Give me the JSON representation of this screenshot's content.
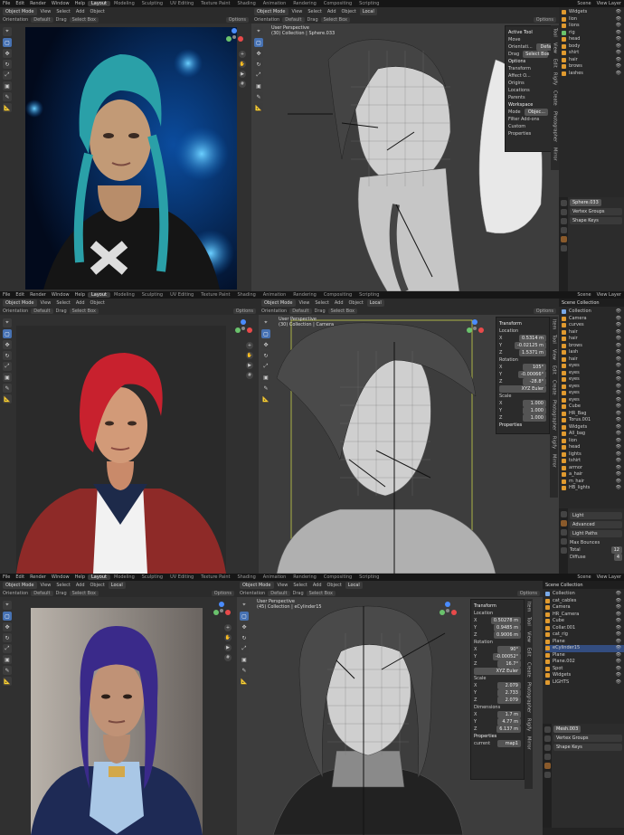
{
  "panels": [
    {
      "topbar": {
        "menus": [
          "File",
          "Edit",
          "Render",
          "Window",
          "Help"
        ],
        "workspaces": [
          "Layout",
          "Modeling",
          "Sculpting",
          "UV Editing",
          "Texture Paint",
          "Shading",
          "Animation",
          "Rendering",
          "Compositing",
          "Scripting"
        ],
        "active_workspace": "Layout",
        "scene": "Scene",
        "view_layer": "View Layer"
      },
      "left_view": {
        "mode": "Object Mode",
        "menus": [
          "View",
          "Select",
          "Add",
          "Object"
        ],
        "orientation_label": "Orientation",
        "orientation": "Default",
        "drag_label": "Drag",
        "drag": "Select Box",
        "options": "Options"
      },
      "right_view": {
        "mode": "Object Mode",
        "menus": [
          "View",
          "Select",
          "Add",
          "Object"
        ],
        "transform": "Local",
        "orientation_label": "Orientation",
        "orientation": "Default",
        "drag_label": "Drag",
        "drag": "Select Box",
        "perspective": "User Perspective",
        "collection": "(30) Collection | Sphere.033",
        "options": "Options"
      },
      "tool_panel": {
        "active_tool": "Active Tool",
        "move": "Move",
        "orientation_label": "Orientati...",
        "orientation": "Default",
        "drag_label": "Drag",
        "drag": "Select Box",
        "options": "Options",
        "transform": "Transform",
        "affect_only": "Affect O...",
        "origins": "Origins",
        "locations": "Locations",
        "parents": "Parents",
        "workspace": "Workspace",
        "mode_label": "Mode",
        "mode": "Objec...",
        "filter_add_ons": "Filter Add-ons",
        "custom_properties": "Custom Properties"
      },
      "tabs": [
        "Tool",
        "View",
        "Edit",
        "Rigify",
        "Create",
        "Photographer",
        "Mirror"
      ],
      "outliner_items": [
        "Widgets",
        "lion",
        "lions",
        "rig",
        "head",
        "body",
        "shirt",
        "hair",
        "brows",
        "lashes"
      ],
      "props": {
        "object": "Sphere.033",
        "vertex_groups": "Vertex Groups",
        "shape_keys": "Shape Keys"
      }
    },
    {
      "topbar": {
        "menus": [
          "File",
          "Edit",
          "Render",
          "Window",
          "Help"
        ],
        "workspaces": [
          "Layout",
          "Modeling",
          "Sculpting",
          "UV Editing",
          "Texture Paint",
          "Shading",
          "Animation",
          "Rendering",
          "Compositing",
          "Scripting"
        ],
        "active_workspace": "Layout",
        "scene": "Scene",
        "view_layer": "View Layer"
      },
      "left_view": {
        "mode": "Object Mode",
        "menus": [
          "View",
          "Select",
          "Add",
          "Object"
        ],
        "orientation_label": "Orientation",
        "orientation": "Default",
        "drag_label": "Drag",
        "drag": "Select Box",
        "options": "Options"
      },
      "right_view": {
        "mode": "Object Mode",
        "menus": [
          "View",
          "Select",
          "Add",
          "Object"
        ],
        "transform": "Local",
        "orientation_label": "Orientation",
        "orientation": "Default",
        "drag_label": "Drag",
        "drag": "Select Box",
        "perspective": "User Perspective",
        "collection": "(30) Collection | Camera",
        "options": "Options"
      },
      "n_panel": {
        "transform": "Transform",
        "location": "Location",
        "loc": [
          "0.5314 m",
          "-0.02125 m",
          "1.5371 m"
        ],
        "rotation": "Rotation",
        "rot": [
          "105°",
          "-0.00066°",
          "-28.8°"
        ],
        "euler": "XYZ Euler",
        "scale": "Scale",
        "scl": [
          "1.000",
          "1.000",
          "1.000"
        ],
        "properties": "Properties"
      },
      "tabs": [
        "Item",
        "Tool",
        "View",
        "Edit",
        "Create",
        "Photographer",
        "Rigify",
        "Mirror"
      ],
      "outliner_header": "Scene Collection",
      "outliner_items": [
        "Collection",
        "Camera",
        "curves",
        "hair",
        "hair",
        "brows",
        "lash",
        "hair",
        "eyes",
        "eyes",
        "eyes",
        "eyes",
        "eyes",
        "eyes",
        "Cube",
        "HR_Bag",
        "Torus.001",
        "Widgets",
        "All_bag",
        "lion",
        "head",
        "lights",
        "tshirt",
        "armor",
        "a_hair",
        "m_hair",
        "HB_lights"
      ],
      "props": {
        "light": "Light",
        "advanced": "Advanced",
        "light_paths": "Light Paths",
        "max_bounces": "Max Bounces",
        "total_label": "Total",
        "total": "12",
        "diffuse_label": "Diffuse",
        "diffuse": "4"
      }
    },
    {
      "topbar": {
        "menus": [
          "File",
          "Edit",
          "Render",
          "Window",
          "Help"
        ],
        "workspaces": [
          "Layout",
          "Modeling",
          "Sculpting",
          "UV Editing",
          "Texture Paint",
          "Shading",
          "Animation",
          "Rendering",
          "Compositing",
          "Scripting"
        ],
        "active_workspace": "Layout",
        "scene": "Scene",
        "view_layer": "View Layer"
      },
      "left_view": {
        "mode": "Object Mode",
        "menus": [
          "View",
          "Select",
          "Add",
          "Object"
        ],
        "transform": "Local",
        "orientation_label": "Orientation",
        "orientation": "Default",
        "drag_label": "Drag",
        "drag": "Select Box",
        "options": "Options"
      },
      "right_view": {
        "mode": "Object Mode",
        "menus": [
          "View",
          "Select",
          "Add",
          "Object"
        ],
        "transform": "Local",
        "orientation_label": "Orientation",
        "orientation": "Default",
        "drag_label": "Drag",
        "drag": "Select Box",
        "perspective": "User Perspective",
        "collection": "(45) Collection | eCylinder15",
        "options": "Options"
      },
      "n_panel": {
        "transform": "Transform",
        "location": "Location",
        "loc": [
          "0.50278 m",
          "0.9485 m",
          "0.9006 m"
        ],
        "rotation": "Rotation",
        "rot": [
          "90°",
          "-0.00052°",
          "16.7°"
        ],
        "euler": "XYZ Euler",
        "scale": "Scale",
        "scl": [
          "2.079",
          "2.733",
          "2.079"
        ],
        "dimensions": "Dimensions",
        "dim": [
          "1.7 m",
          "4.77 m",
          "6.137 m"
        ],
        "properties": "Properties",
        "current_label": "current",
        "current": "map1"
      },
      "tabs": [
        "Item",
        "Tool",
        "View",
        "Edit",
        "Create",
        "Photographer",
        "Rigify",
        "Mirror"
      ],
      "outliner_header": "Scene Collection",
      "outliner_items": [
        "Collection",
        "cat_cables",
        "Camera",
        "HR_Camera",
        "Cube",
        "Collar.001",
        "cat_rig",
        "Plane",
        "eCylinder15",
        "Plane",
        "Plane.002",
        "Spot",
        "Widgets",
        "LIGHTS"
      ],
      "props": {
        "mesh": "Mesh.003",
        "vertex_groups": "Vertex Groups",
        "shape_keys": "Shape Keys"
      }
    }
  ]
}
